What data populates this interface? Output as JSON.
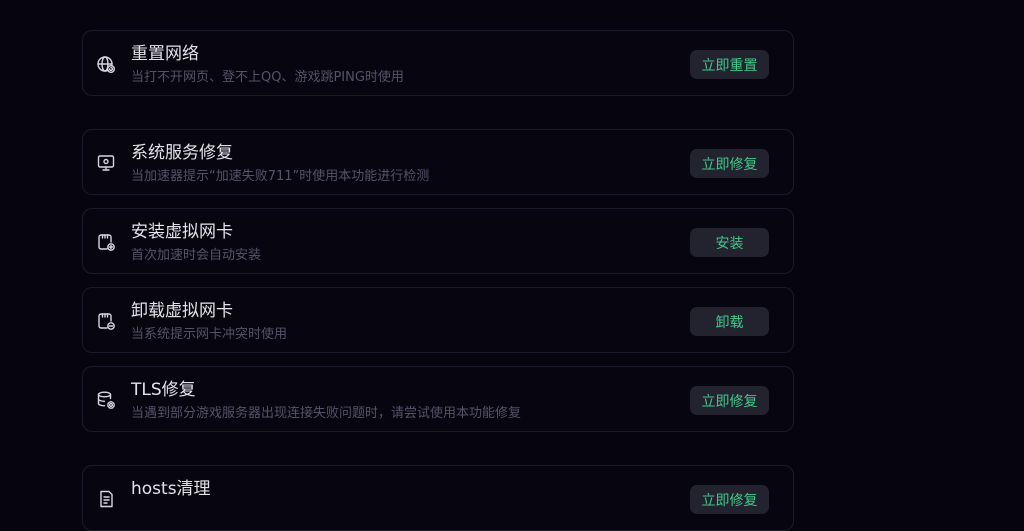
{
  "items": [
    {
      "title": "重置网络",
      "desc": "当打不开网页、登不上QQ、游戏跳PING时使用",
      "action": "立即重置",
      "icon": "globe-reset-icon"
    },
    {
      "title": "系统服务修复",
      "desc": "当加速器提示“加速失败711”时使用本功能进行检测",
      "action": "立即修复",
      "icon": "monitor-service-icon"
    },
    {
      "title": "安装虚拟网卡",
      "desc": "首次加速时会自动安装",
      "action": "安装",
      "icon": "network-card-install-icon"
    },
    {
      "title": "卸载虚拟网卡",
      "desc": "当系统提示网卡冲突时使用",
      "action": "卸载",
      "icon": "network-card-uninstall-icon"
    },
    {
      "title": "TLS修复",
      "desc": "当遇到部分游戏服务器出现连接失败问题时，请尝试使用本功能修复",
      "action": "立即修复",
      "icon": "database-gear-icon"
    },
    {
      "title": "hosts清理",
      "desc": "",
      "action": "立即修复",
      "icon": "document-clean-icon"
    }
  ],
  "colors": {
    "background": "#06040f",
    "card_border": "#1d1b2b",
    "button_bg": "#23222f",
    "accent": "#3fc98a",
    "title": "#e4e3ec",
    "desc": "#55536a"
  }
}
